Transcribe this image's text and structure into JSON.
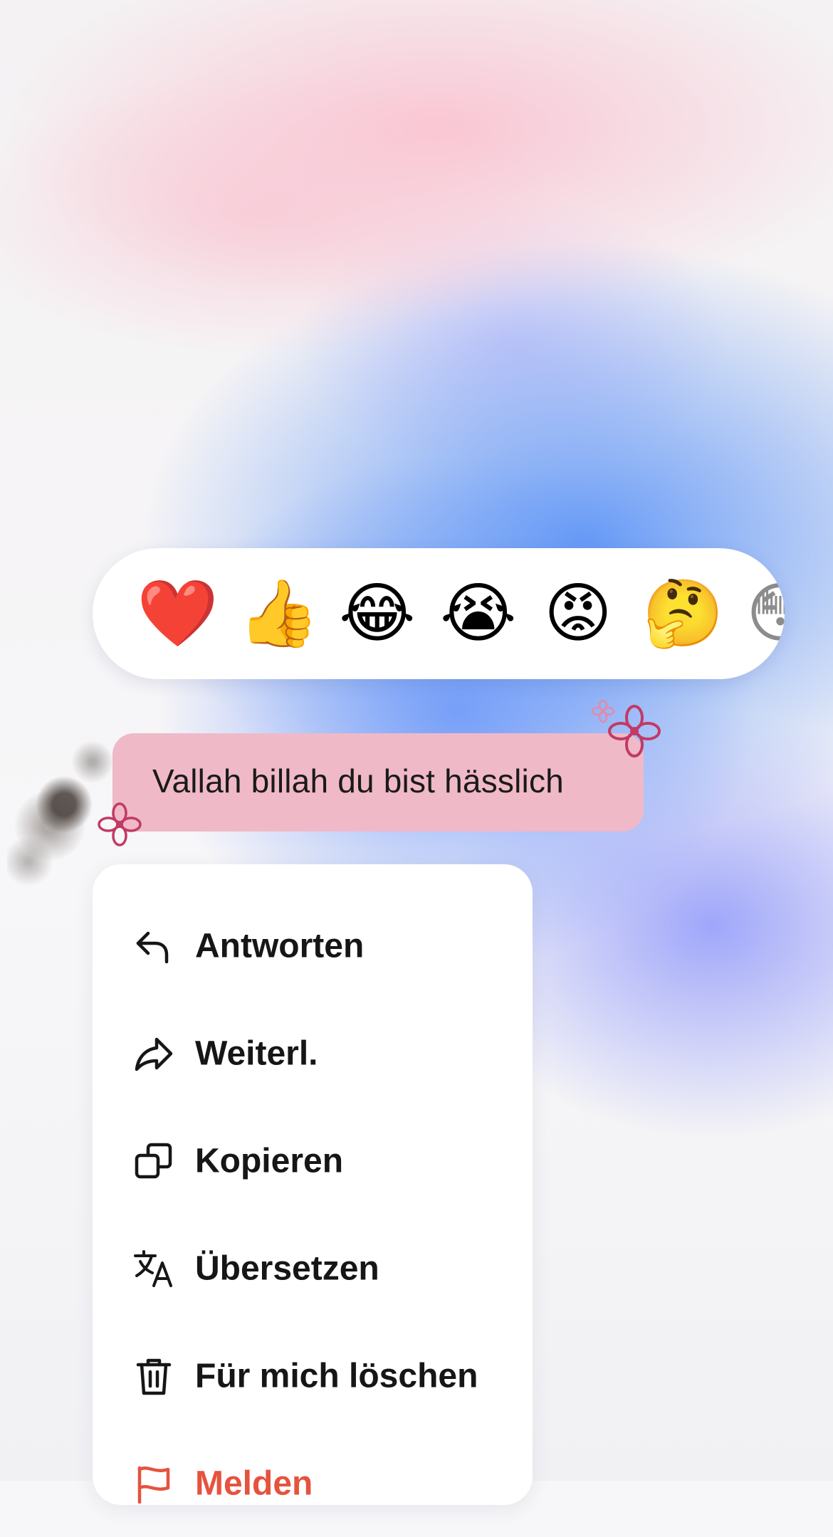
{
  "reactions": [
    {
      "name": "heart",
      "glyph": "❤️"
    },
    {
      "name": "thumbs-up",
      "glyph": "👍"
    },
    {
      "name": "tears-of-joy",
      "glyph": "😂"
    },
    {
      "name": "loudly-crying",
      "glyph": "😭"
    },
    {
      "name": "angry",
      "glyph": "😡"
    },
    {
      "name": "thinking",
      "glyph": "🤔"
    },
    {
      "name": "partial-face",
      "glyph": "😳"
    }
  ],
  "message": {
    "text": "Vallah billah du bist hässlich",
    "bubble_color": "#f0b9c8"
  },
  "menu": {
    "items": [
      {
        "id": "reply",
        "label": "Antworten",
        "icon": "reply-arrow-icon"
      },
      {
        "id": "forward",
        "label": "Weiterl.",
        "icon": "forward-arrow-icon"
      },
      {
        "id": "copy",
        "label": "Kopieren",
        "icon": "copy-icon"
      },
      {
        "id": "translate",
        "label": "Übersetzen",
        "icon": "translate-icon"
      },
      {
        "id": "delete",
        "label": "Für mich löschen",
        "icon": "trash-icon"
      },
      {
        "id": "report",
        "label": "Melden",
        "icon": "flag-icon",
        "color": "#e5533f"
      }
    ]
  },
  "colors": {
    "report_red": "#e5533f",
    "menu_text": "#161616"
  }
}
